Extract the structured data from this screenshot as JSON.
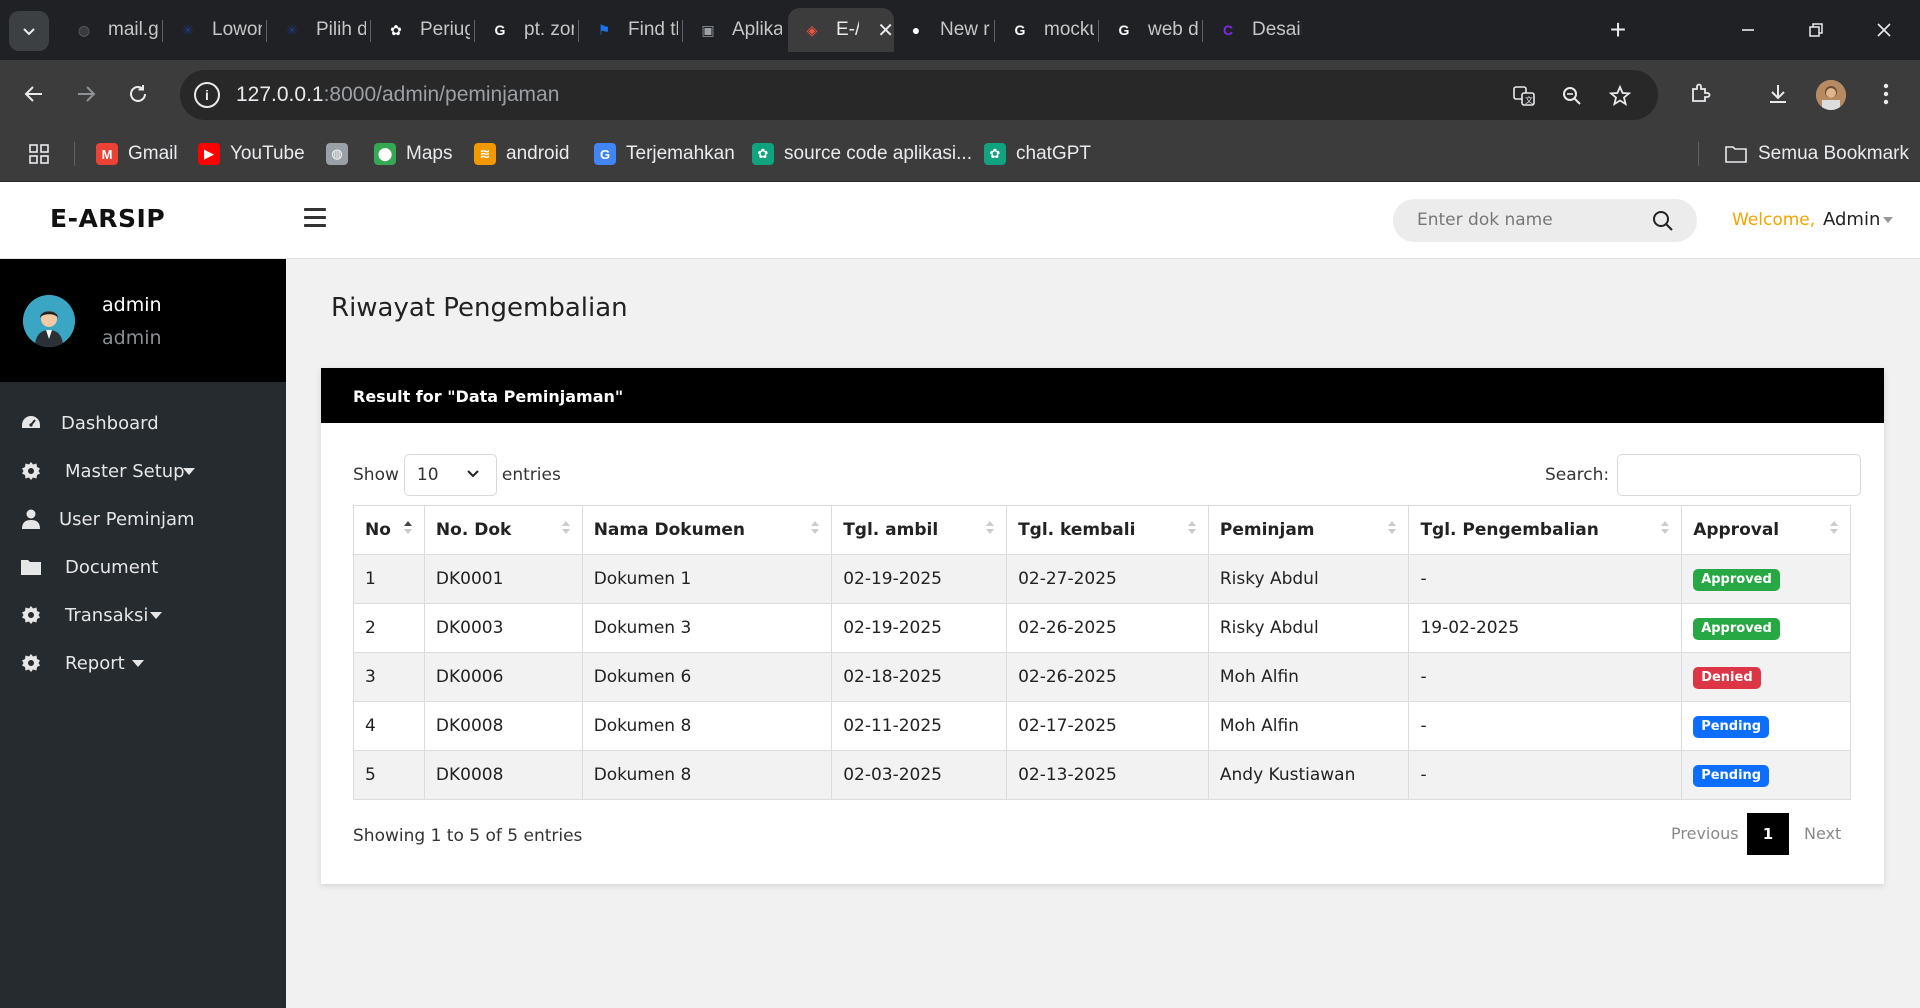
{
  "browser": {
    "tabs": [
      {
        "title": "mail.go",
        "fav": "globe-icon",
        "color": "#5f6368"
      },
      {
        "title": "Lowong",
        "fav": "jobstreet-icon",
        "color": "#1c3c8c"
      },
      {
        "title": "Pilih dc",
        "fav": "jobstreet-icon",
        "color": "#1c3c8c"
      },
      {
        "title": "Periuga",
        "fav": "chatgpt-icon",
        "color": "#ffffff"
      },
      {
        "title": "pt. zon",
        "fav": "google-icon",
        "color": "#ffffff"
      },
      {
        "title": "Find th",
        "fav": "flag-icon",
        "color": "#1a73e8"
      },
      {
        "title": "Aplikas",
        "fav": "monitor-icon",
        "color": "#9aa0a6"
      },
      {
        "title": "E-/",
        "fav": "laravel-icon",
        "color": "#f05340"
      },
      {
        "title": "New re",
        "fav": "github-icon",
        "color": "#ffffff"
      },
      {
        "title": "mocku",
        "fav": "google-icon",
        "color": "#ffffff"
      },
      {
        "title": "web de",
        "fav": "google-icon",
        "color": "#ffffff"
      },
      {
        "title": "Desain",
        "fav": "canva-icon",
        "color": "#7d2ae8"
      }
    ],
    "active_tab_index": 7,
    "url_host": "127.0.0.1",
    "url_rest": ":8000/admin/peminjaman",
    "bookmarks": [
      {
        "label": "Gmail",
        "icon": "gmail-icon"
      },
      {
        "label": "YouTube",
        "icon": "youtube-icon"
      },
      {
        "label": "",
        "icon": "globe-icon"
      },
      {
        "label": "Maps",
        "icon": "maps-icon"
      },
      {
        "label": "android",
        "icon": "android-icon"
      },
      {
        "label": "Terjemahkan",
        "icon": "translate-icon"
      },
      {
        "label": "source code aplikasi...",
        "icon": "chatgpt-icon"
      },
      {
        "label": "chatGPT",
        "icon": "chatgpt-icon"
      }
    ],
    "all_bookmarks": "Semua Bookmark"
  },
  "app": {
    "brand": "E-ARSIP",
    "search_placeholder": "Enter dok name",
    "welcome": "Welcome,",
    "user_menu": "Admin",
    "accent": "#f0a500"
  },
  "sidebar": {
    "user_name": "admin",
    "user_role": "admin",
    "items": [
      {
        "label": "Dashboard",
        "icon": "dashboard-icon",
        "has_caret": false
      },
      {
        "label": "Master Setup",
        "icon": "gear-icon",
        "has_caret": true
      },
      {
        "label": "User Peminjam",
        "icon": "user-icon",
        "has_caret": false
      },
      {
        "label": "Document",
        "icon": "folder-icon",
        "has_caret": false
      },
      {
        "label": "Transaksi",
        "icon": "gear-icon",
        "has_caret": true
      },
      {
        "label": "Report",
        "icon": "gear-icon",
        "has_caret": true
      }
    ]
  },
  "main": {
    "page_title": "Riwayat Pengembalian",
    "card_title": "Result for \"Data Peminjaman\"",
    "show_label": "Show",
    "entries_value": "10",
    "entries_label": "entries",
    "search_label": "Search:",
    "search_value": "",
    "columns": [
      "No",
      "No. Dok",
      "Nama Dokumen",
      "Tgl. ambil",
      "Tgl. kembali",
      "Peminjam",
      "Tgl. Pengembalian",
      "Approval"
    ],
    "rows": [
      {
        "no": "1",
        "dok": "DK0001",
        "nama": "Dokumen 1",
        "ambil": "02-19-2025",
        "kembali": "02-27-2025",
        "peminjam": "Risky Abdul",
        "pengembalian": "-",
        "approval": "Approved",
        "status": "approved"
      },
      {
        "no": "2",
        "dok": "DK0003",
        "nama": "Dokumen 3",
        "ambil": "02-19-2025",
        "kembali": "02-26-2025",
        "peminjam": "Risky Abdul",
        "pengembalian": "19-02-2025",
        "approval": "Approved",
        "status": "approved"
      },
      {
        "no": "3",
        "dok": "DK0006",
        "nama": "Dokumen 6",
        "ambil": "02-18-2025",
        "kembali": "02-26-2025",
        "peminjam": "Moh Alfin",
        "pengembalian": "-",
        "approval": "Denied",
        "status": "denied"
      },
      {
        "no": "4",
        "dok": "DK0008",
        "nama": "Dokumen 8",
        "ambil": "02-11-2025",
        "kembali": "02-17-2025",
        "peminjam": "Moh Alfin",
        "pengembalian": "-",
        "approval": "Pending",
        "status": "pending"
      },
      {
        "no": "5",
        "dok": "DK0008",
        "nama": "Dokumen 8",
        "ambil": "02-03-2025",
        "kembali": "02-13-2025",
        "peminjam": "Andy Kustiawan",
        "pengembalian": "-",
        "approval": "Pending",
        "status": "pending"
      }
    ],
    "status_colors": {
      "approved": "#28a745",
      "denied": "#dc3545",
      "pending": "#0d6efd"
    },
    "info": "Showing 1 to 5 of 5 entries",
    "prev": "Previous",
    "page": "1",
    "next": "Next"
  }
}
